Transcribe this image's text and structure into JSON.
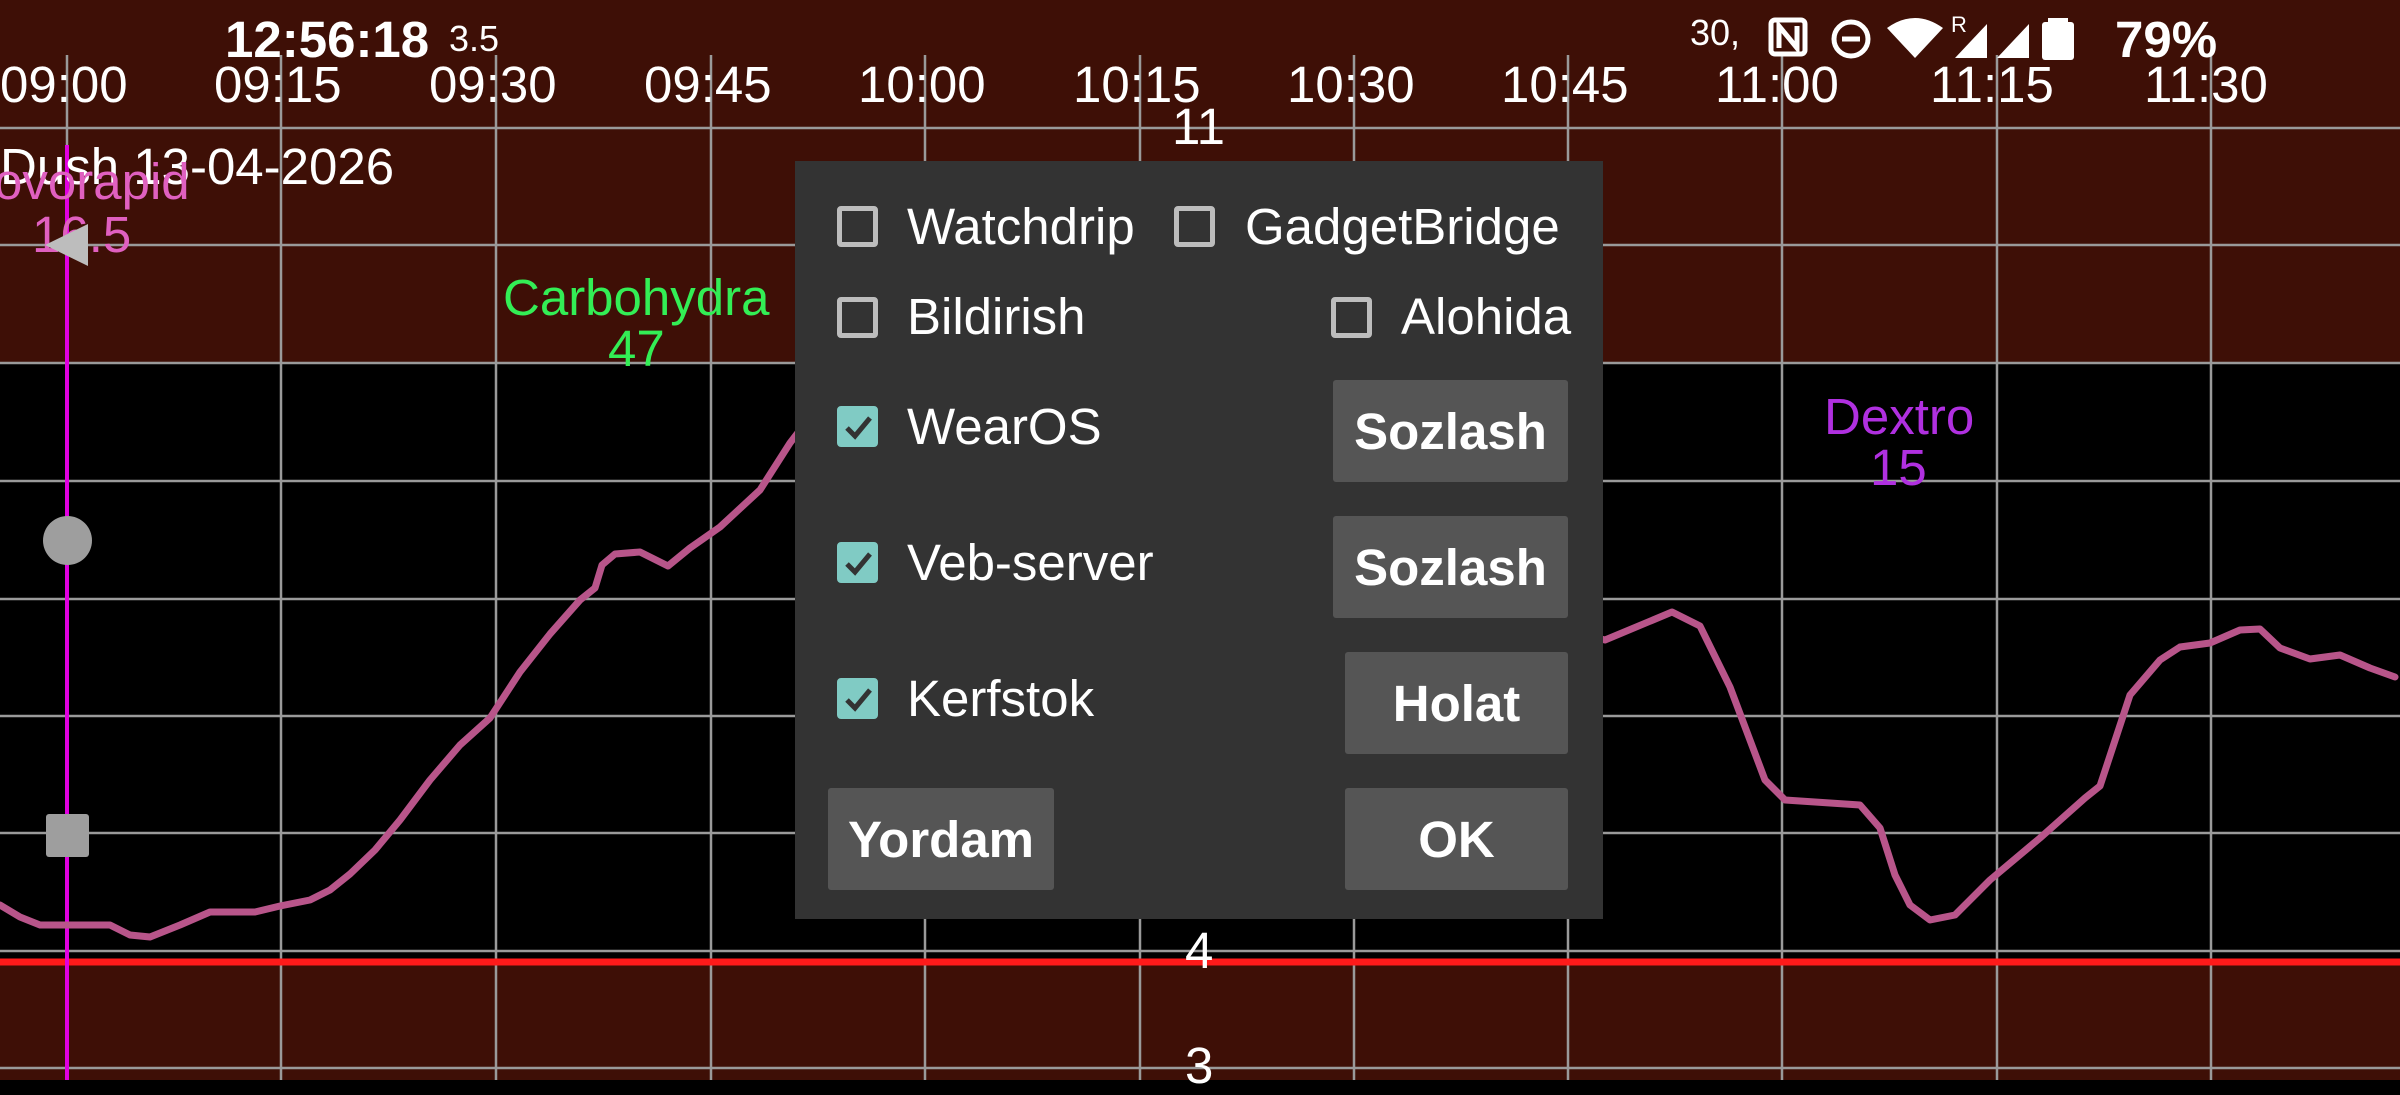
{
  "status_bar": {
    "clock": "12:56:18",
    "net_speed": "3.5",
    "extra": "30,",
    "battery": "79%",
    "icons": [
      "nfc-icon",
      "dnd-icon",
      "wifi-icon",
      "signal-roaming-icon",
      "signal-icon",
      "battery-icon"
    ]
  },
  "graph": {
    "date": "Dush 13-04-2026",
    "time_axis": [
      "09:00",
      "09:15",
      "09:30",
      "09:45",
      "10:00",
      "10:15",
      "10:30",
      "10:45",
      "11:00",
      "11:15",
      "11:30"
    ],
    "y_labels": [
      "11",
      "4",
      "3"
    ],
    "treatments": {
      "insulin": {
        "label": "ovorapid",
        "value": "16.5",
        "color": "#e060c0"
      },
      "carbs": {
        "label": "Carbohydra",
        "value": "47",
        "color": "#33ee55"
      },
      "dextro": {
        "label": "Dextro",
        "value": "15",
        "color": "#b030e0"
      }
    },
    "colors": {
      "background": "#000000",
      "out_of_range": "#3e0f06",
      "grid": "#9a9a9a",
      "line": "#b8558a",
      "low_line": "#ff1a1a",
      "marker_line": "#e000e0"
    }
  },
  "dialog": {
    "checkboxes": {
      "watchdrip": {
        "label": "Watchdrip",
        "checked": false
      },
      "gadgetbridge": {
        "label": "GadgetBridge",
        "checked": false
      },
      "bildirish": {
        "label": "Bildirish",
        "checked": false
      },
      "alohida": {
        "label": "Alohida",
        "checked": false
      },
      "wearos": {
        "label": "WearOS",
        "checked": true
      },
      "veb_server": {
        "label": "Veb-server",
        "checked": true
      },
      "kerfstok": {
        "label": "Kerfstok",
        "checked": true
      }
    },
    "buttons": {
      "wearos_settings": "Sozlash",
      "veb_settings": "Sozlash",
      "kerfstok_status": "Holat",
      "help": "Yordam",
      "ok": "OK"
    }
  }
}
